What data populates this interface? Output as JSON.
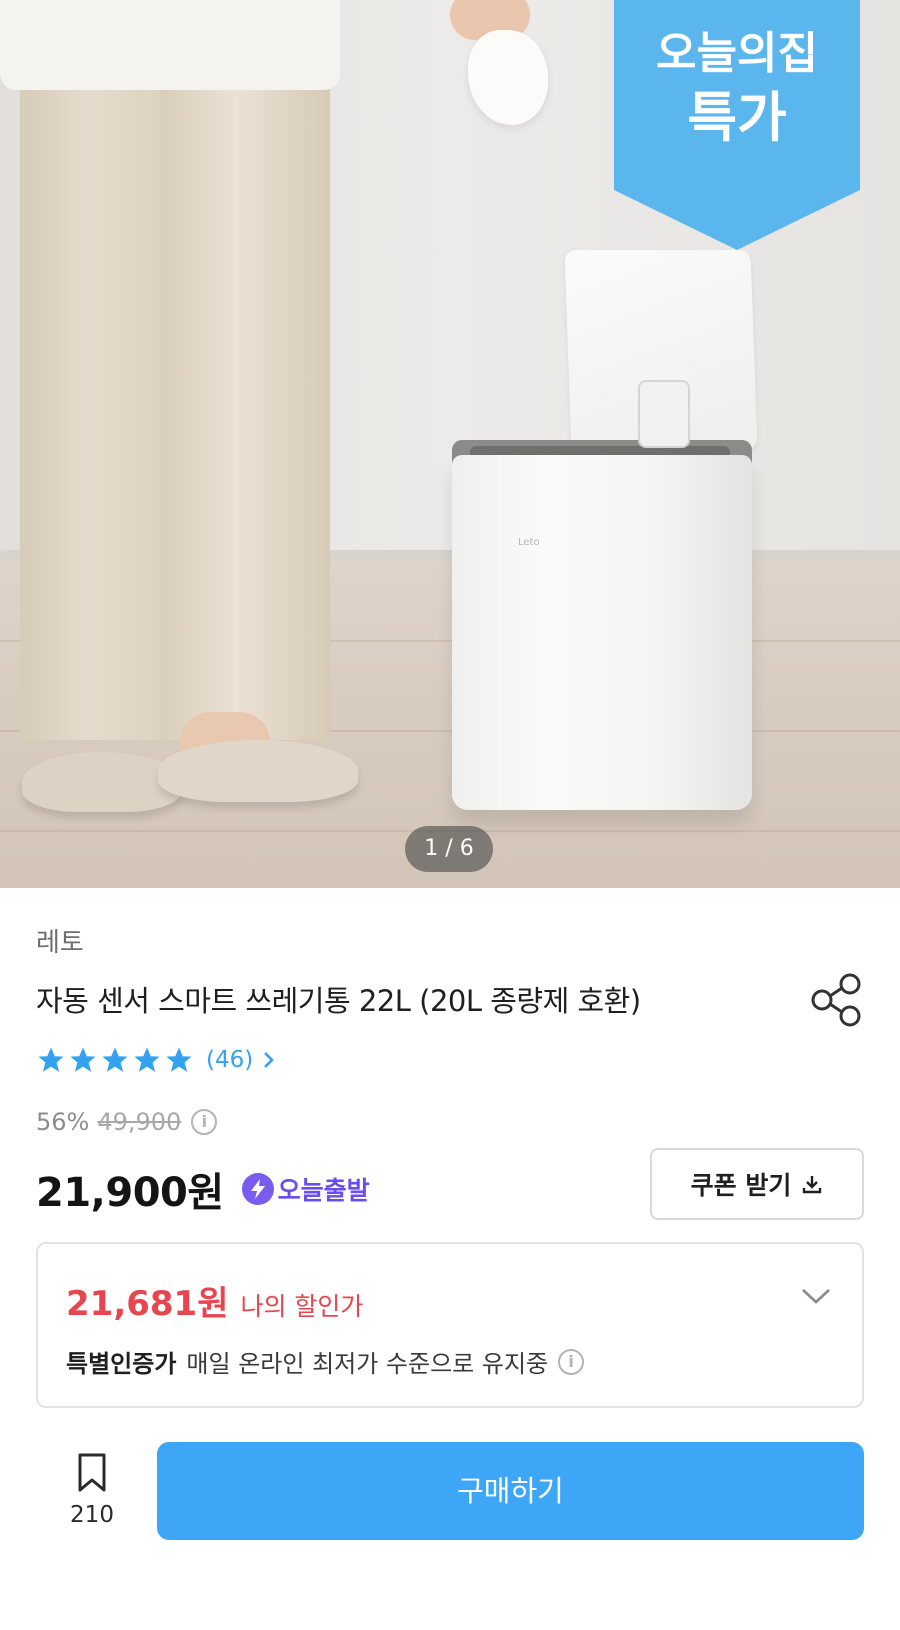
{
  "hero": {
    "badge_line1": "오늘의집",
    "badge_line2": "특가",
    "badge_color": "#5cb6ee",
    "image_counter": "1 / 6"
  },
  "product": {
    "brand": "레토",
    "title": "자동 센서 스마트 쓰레기통 22L (20L 종량제 호환)",
    "rating_stars": 5,
    "review_count": "(46)",
    "discount_percent": "56%",
    "original_price": "49,900",
    "price": "21,900원",
    "delivery_badge": "오늘출발"
  },
  "coupon": {
    "label": "쿠폰 받기"
  },
  "my_price": {
    "price": "21,681원",
    "label": "나의 할인가",
    "cert_strong": "특별인증가",
    "cert_desc": "매일 온라인 최저가 수준으로 유지중"
  },
  "bottom_bar": {
    "bookmark_count": "210",
    "buy_label": "구매하기"
  },
  "icons": {
    "share": "share-icon",
    "star": "star-icon",
    "chevron_right": "chevron-right-icon",
    "info": "info-icon",
    "bolt": "bolt-icon",
    "download": "download-icon",
    "chevron_down": "chevron-down-icon",
    "bookmark": "bookmark-icon"
  },
  "colors": {
    "accent_blue": "#3ea6f7",
    "star_blue": "#35a2ee",
    "sale_red": "#e8464f",
    "delivery_purple": "#6a4df0"
  }
}
